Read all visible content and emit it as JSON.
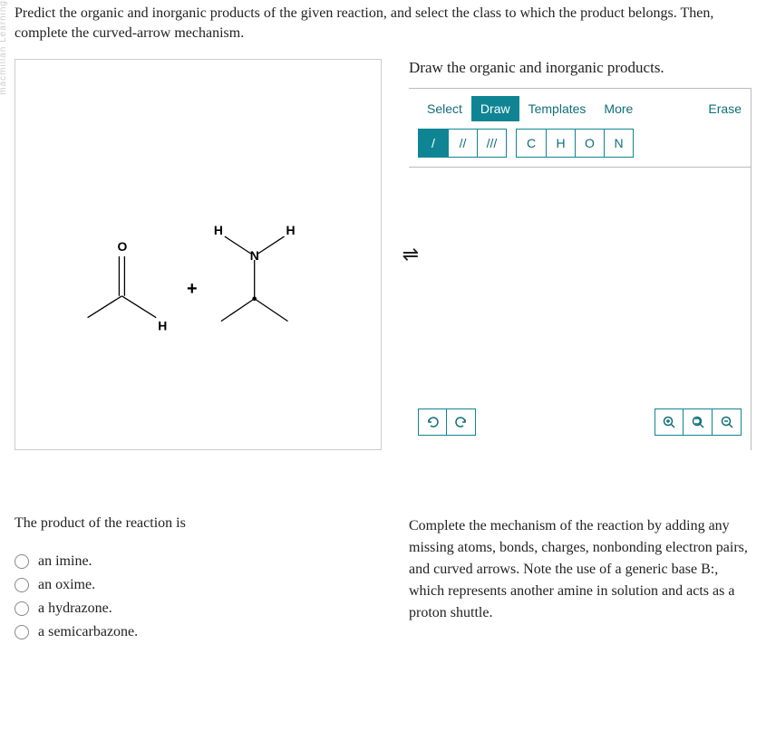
{
  "instruction": "Predict the organic and inorganic products of the given reaction, and select the class to which the product belongs. Then, complete the curved-arrow mechanism.",
  "reaction": {
    "plus": "+",
    "equil": "⇌",
    "atoms": {
      "O": "O",
      "H1": "H",
      "H2": "H",
      "H3": "H",
      "N": "N"
    }
  },
  "drawer": {
    "title": "Draw the organic and inorganic products.",
    "tabs": {
      "select": "Select",
      "draw": "Draw",
      "templates": "Templates",
      "more": "More"
    },
    "erase": "Erase",
    "bonds": {
      "single": "/",
      "double": "//",
      "triple": "///"
    },
    "atoms": {
      "C": "C",
      "H": "H",
      "O": "O",
      "N": "N"
    }
  },
  "question": {
    "title": "The product of the reaction is",
    "options": [
      "an imine.",
      "an oxime.",
      "a hydrazone.",
      "a semicarbazone."
    ]
  },
  "mechanism_text": "Complete the mechanism of the reaction by adding any missing atoms, bonds, charges, nonbonding electron pairs, and curved arrows. Note the use of a generic base B:, which represents another amine in solution and acts as a proton shuttle."
}
